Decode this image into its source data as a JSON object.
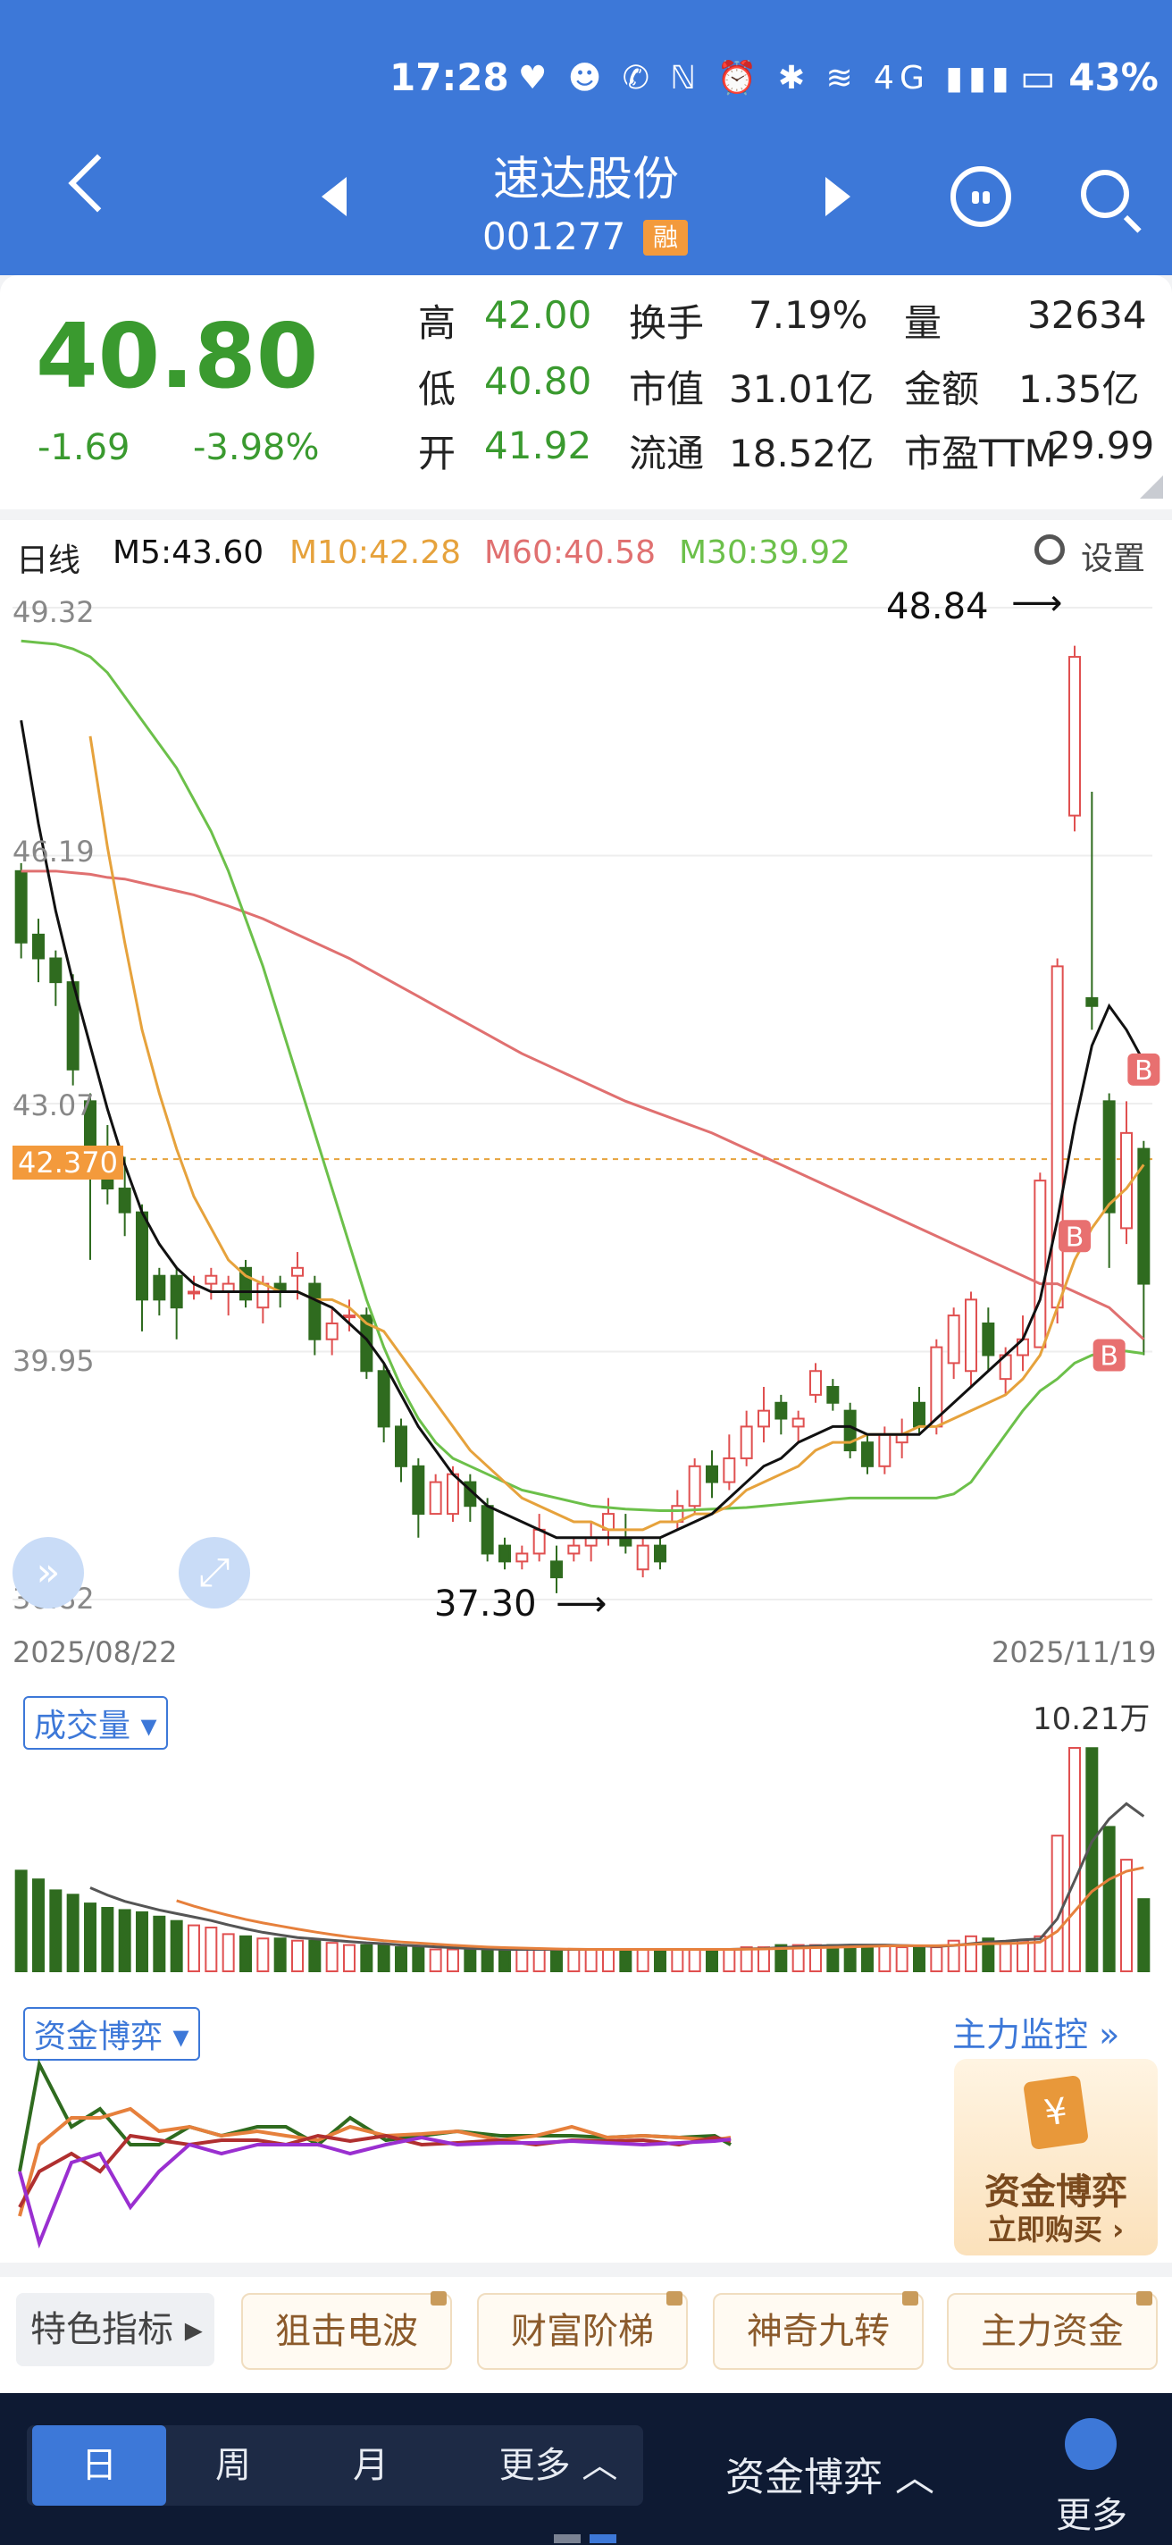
{
  "status": {
    "time": "17:28",
    "icons": "♥ ☻ ✆ ℕ ⏰ ✱ ≋ 4G ▮▮▮",
    "battery": "▭ 43%"
  },
  "header": {
    "stock_name": "速达股份",
    "stock_code": "001277",
    "badge": "融"
  },
  "quote": {
    "price": "40.80",
    "change": "-1.69",
    "change_pct": "-3.98%",
    "high_label": "高",
    "high": "42.00",
    "low_label": "低",
    "low": "40.80",
    "open_label": "开",
    "open": "41.92",
    "turnover_label": "换手",
    "turnover": "7.19%",
    "mcap_label": "市值",
    "mcap": "31.01亿",
    "float_label": "流通",
    "float": "18.52亿",
    "vol_label": "量",
    "vol": "32634",
    "amount_label": "金额",
    "amount": "1.35亿",
    "pe_label": "市盈TTM",
    "pe": "29.99"
  },
  "chart_header": {
    "period": "日线",
    "m5": "M5:43.60",
    "m10": "M10:42.28",
    "m60": "M60:40.58",
    "m30": "M30:39.92",
    "settings": "设置",
    "colors": {
      "m5": "#111111",
      "m10": "#e6a23c",
      "m60": "#e07070",
      "m30": "#6cc04a",
      "up": "#e05050",
      "down": "#2f6b1f"
    }
  },
  "chart_data": {
    "type": "candlestick",
    "y_ticks": [
      "49.32",
      "46.19",
      "43.07",
      "39.95",
      "36.82"
    ],
    "ylim": [
      36.82,
      49.32
    ],
    "current_price_tag": "42.370",
    "date_start": "2025/08/22",
    "date_end": "2025/11/19",
    "high_annotation": "48.84",
    "low_annotation": "37.30",
    "candles": [
      {
        "o": 46.0,
        "h": 46.1,
        "l": 44.9,
        "c": 45.1
      },
      {
        "o": 45.2,
        "h": 45.4,
        "l": 44.6,
        "c": 44.9
      },
      {
        "o": 44.9,
        "h": 45.0,
        "l": 44.3,
        "c": 44.6
      },
      {
        "o": 44.6,
        "h": 44.7,
        "l": 43.3,
        "c": 43.5
      },
      {
        "o": 43.1,
        "h": 43.2,
        "l": 41.1,
        "c": 42.5
      },
      {
        "o": 42.5,
        "h": 42.8,
        "l": 41.8,
        "c": 42.0
      },
      {
        "o": 42.0,
        "h": 42.4,
        "l": 41.4,
        "c": 41.7
      },
      {
        "o": 41.7,
        "h": 41.8,
        "l": 40.2,
        "c": 40.6
      },
      {
        "o": 40.9,
        "h": 41.0,
        "l": 40.4,
        "c": 40.6
      },
      {
        "o": 40.9,
        "h": 41.0,
        "l": 40.1,
        "c": 40.5
      },
      {
        "o": 40.7,
        "h": 40.9,
        "l": 40.6,
        "c": 40.7
      },
      {
        "o": 40.8,
        "h": 41.0,
        "l": 40.6,
        "c": 40.9
      },
      {
        "o": 40.7,
        "h": 40.9,
        "l": 40.4,
        "c": 40.8
      },
      {
        "o": 41.0,
        "h": 41.1,
        "l": 40.5,
        "c": 40.6
      },
      {
        "o": 40.5,
        "h": 40.9,
        "l": 40.3,
        "c": 40.8
      },
      {
        "o": 40.8,
        "h": 40.9,
        "l": 40.5,
        "c": 40.7
      },
      {
        "o": 40.9,
        "h": 41.2,
        "l": 40.6,
        "c": 41.0
      },
      {
        "o": 40.8,
        "h": 40.9,
        "l": 39.9,
        "c": 40.1
      },
      {
        "o": 40.1,
        "h": 40.5,
        "l": 39.9,
        "c": 40.3
      },
      {
        "o": 40.4,
        "h": 40.6,
        "l": 40.2,
        "c": 40.4
      },
      {
        "o": 40.4,
        "h": 40.5,
        "l": 39.6,
        "c": 39.7
      },
      {
        "o": 39.7,
        "h": 39.8,
        "l": 38.8,
        "c": 39.0
      },
      {
        "o": 39.0,
        "h": 39.1,
        "l": 38.3,
        "c": 38.5
      },
      {
        "o": 38.5,
        "h": 38.6,
        "l": 37.6,
        "c": 37.9
      },
      {
        "o": 37.9,
        "h": 38.4,
        "l": 37.9,
        "c": 38.3
      },
      {
        "o": 37.9,
        "h": 38.5,
        "l": 37.8,
        "c": 38.4
      },
      {
        "o": 38.3,
        "h": 38.4,
        "l": 37.8,
        "c": 38.0
      },
      {
        "o": 38.0,
        "h": 38.1,
        "l": 37.3,
        "c": 37.4
      },
      {
        "o": 37.5,
        "h": 37.6,
        "l": 37.2,
        "c": 37.3
      },
      {
        "o": 37.3,
        "h": 37.5,
        "l": 37.2,
        "c": 37.4
      },
      {
        "o": 37.4,
        "h": 37.9,
        "l": 37.3,
        "c": 37.7
      },
      {
        "o": 37.3,
        "h": 37.5,
        "l": 36.9,
        "c": 37.1
      },
      {
        "o": 37.4,
        "h": 37.6,
        "l": 37.3,
        "c": 37.5
      },
      {
        "o": 37.5,
        "h": 37.8,
        "l": 37.3,
        "c": 37.6
      },
      {
        "o": 37.7,
        "h": 38.1,
        "l": 37.5,
        "c": 37.9
      },
      {
        "o": 37.6,
        "h": 37.9,
        "l": 37.4,
        "c": 37.5
      },
      {
        "o": 37.2,
        "h": 37.6,
        "l": 37.1,
        "c": 37.5
      },
      {
        "o": 37.5,
        "h": 37.6,
        "l": 37.2,
        "c": 37.3
      },
      {
        "o": 37.8,
        "h": 38.2,
        "l": 37.7,
        "c": 38.0
      },
      {
        "o": 38.0,
        "h": 38.6,
        "l": 37.9,
        "c": 38.5
      },
      {
        "o": 38.5,
        "h": 38.7,
        "l": 38.1,
        "c": 38.3
      },
      {
        "o": 38.3,
        "h": 38.9,
        "l": 38.2,
        "c": 38.6
      },
      {
        "o": 38.6,
        "h": 39.2,
        "l": 38.5,
        "c": 39.0
      },
      {
        "o": 39.0,
        "h": 39.5,
        "l": 38.8,
        "c": 39.2
      },
      {
        "o": 39.3,
        "h": 39.4,
        "l": 38.9,
        "c": 39.1
      },
      {
        "o": 39.0,
        "h": 39.2,
        "l": 38.8,
        "c": 39.1
      },
      {
        "o": 39.4,
        "h": 39.8,
        "l": 39.3,
        "c": 39.7
      },
      {
        "o": 39.5,
        "h": 39.6,
        "l": 39.2,
        "c": 39.3
      },
      {
        "o": 39.2,
        "h": 39.3,
        "l": 38.6,
        "c": 38.7
      },
      {
        "o": 38.8,
        "h": 38.9,
        "l": 38.4,
        "c": 38.5
      },
      {
        "o": 38.5,
        "h": 39.0,
        "l": 38.4,
        "c": 38.9
      },
      {
        "o": 38.8,
        "h": 39.1,
        "l": 38.6,
        "c": 38.9
      },
      {
        "o": 39.3,
        "h": 39.5,
        "l": 38.9,
        "c": 39.0
      },
      {
        "o": 39.0,
        "h": 40.1,
        "l": 38.9,
        "c": 40.0
      },
      {
        "o": 39.8,
        "h": 40.5,
        "l": 39.6,
        "c": 40.4
      },
      {
        "o": 39.7,
        "h": 40.7,
        "l": 39.5,
        "c": 40.6
      },
      {
        "o": 40.3,
        "h": 40.5,
        "l": 39.7,
        "c": 39.9
      },
      {
        "o": 39.6,
        "h": 40.0,
        "l": 39.4,
        "c": 39.9
      },
      {
        "o": 39.9,
        "h": 40.4,
        "l": 39.7,
        "c": 40.1
      },
      {
        "o": 40.0,
        "h": 42.2,
        "l": 40.0,
        "c": 42.1
      },
      {
        "o": 40.5,
        "h": 44.9,
        "l": 40.3,
        "c": 44.8
      },
      {
        "o": 46.7,
        "h": 48.84,
        "l": 46.5,
        "c": 48.7
      },
      {
        "o": 44.4,
        "h": 47.0,
        "l": 44.0,
        "c": 44.3
      },
      {
        "o": 43.1,
        "h": 43.2,
        "l": 41.0,
        "c": 41.7
      },
      {
        "o": 41.5,
        "h": 43.1,
        "l": 41.3,
        "c": 42.7
      },
      {
        "o": 42.5,
        "h": 42.6,
        "l": 39.9,
        "c": 40.8
      }
    ],
    "ma": {
      "m5": [
        47.9,
        46.6,
        45.5,
        44.6,
        43.8,
        43.0,
        42.3,
        41.7,
        41.3,
        41.0,
        40.8,
        40.7,
        40.7,
        40.7,
        40.7,
        40.7,
        40.7,
        40.6,
        40.5,
        40.3,
        40.1,
        39.8,
        39.4,
        39.0,
        38.7,
        38.4,
        38.2,
        38.0,
        37.9,
        37.8,
        37.7,
        37.6,
        37.6,
        37.6,
        37.6,
        37.6,
        37.6,
        37.6,
        37.7,
        37.8,
        37.9,
        38.1,
        38.3,
        38.5,
        38.6,
        38.8,
        38.9,
        39.0,
        39.0,
        38.9,
        38.9,
        38.9,
        38.9,
        39.1,
        39.3,
        39.5,
        39.7,
        39.9,
        40.1,
        40.6,
        41.6,
        42.8,
        43.8,
        44.3,
        44.0,
        43.6
      ],
      "m10": [
        null,
        null,
        null,
        null,
        47.7,
        46.3,
        45.1,
        44.0,
        43.2,
        42.5,
        41.9,
        41.5,
        41.1,
        40.9,
        40.8,
        40.7,
        40.7,
        40.6,
        40.6,
        40.5,
        40.3,
        40.2,
        39.9,
        39.6,
        39.3,
        39.0,
        38.7,
        38.5,
        38.3,
        38.1,
        38.0,
        37.9,
        37.8,
        37.8,
        37.7,
        37.7,
        37.7,
        37.8,
        37.8,
        37.9,
        37.9,
        38.0,
        38.2,
        38.3,
        38.4,
        38.5,
        38.7,
        38.8,
        38.8,
        38.9,
        38.9,
        38.9,
        39.0,
        39.0,
        39.1,
        39.2,
        39.3,
        39.4,
        39.6,
        39.9,
        40.5,
        41.1,
        41.5,
        41.8,
        42.0,
        42.3
      ],
      "m60": [
        46.0,
        46.0,
        46.0,
        45.98,
        45.96,
        45.92,
        45.9,
        45.85,
        45.8,
        45.75,
        45.7,
        45.63,
        45.56,
        45.48,
        45.4,
        45.3,
        45.2,
        45.1,
        45.0,
        44.9,
        44.78,
        44.66,
        44.54,
        44.42,
        44.3,
        44.18,
        44.06,
        43.94,
        43.82,
        43.7,
        43.6,
        43.5,
        43.4,
        43.3,
        43.2,
        43.1,
        43.02,
        42.94,
        42.86,
        42.78,
        42.7,
        42.6,
        42.5,
        42.4,
        42.3,
        42.2,
        42.1,
        42.0,
        41.9,
        41.8,
        41.7,
        41.6,
        41.5,
        41.4,
        41.3,
        41.2,
        41.1,
        41.0,
        40.9,
        40.8,
        40.8,
        40.7,
        40.6,
        40.5,
        40.3,
        40.1
      ],
      "m30": [
        48.9,
        48.88,
        48.86,
        48.8,
        48.7,
        48.5,
        48.2,
        47.9,
        47.6,
        47.3,
        46.9,
        46.5,
        46.0,
        45.4,
        44.8,
        44.1,
        43.4,
        42.7,
        42.0,
        41.3,
        40.6,
        40.0,
        39.5,
        39.1,
        38.8,
        38.6,
        38.5,
        38.4,
        38.3,
        38.2,
        38.15,
        38.1,
        38.05,
        38.0,
        37.98,
        37.96,
        37.95,
        37.94,
        37.94,
        37.95,
        37.96,
        37.97,
        37.98,
        38.0,
        38.02,
        38.04,
        38.06,
        38.08,
        38.1,
        38.1,
        38.1,
        38.1,
        38.1,
        38.1,
        38.15,
        38.3,
        38.6,
        38.9,
        39.2,
        39.45,
        39.6,
        39.8,
        39.9,
        39.95,
        39.95,
        39.92
      ]
    },
    "volume": {
      "label": "成交量",
      "max_label": "10.21万",
      "values": [
        4.6,
        4.2,
        3.7,
        3.5,
        3.1,
        2.9,
        2.8,
        2.7,
        2.5,
        2.3,
        2.1,
        2.0,
        1.7,
        1.6,
        1.5,
        1.5,
        1.4,
        1.4,
        1.3,
        1.2,
        1.2,
        1.2,
        1.1,
        1.1,
        1.0,
        1.0,
        1.0,
        1.0,
        1.0,
        1.0,
        1.0,
        1.0,
        1.0,
        1.0,
        1.0,
        1.0,
        1.0,
        1.0,
        1.0,
        1.0,
        1.0,
        1.0,
        1.1,
        1.1,
        1.2,
        1.2,
        1.2,
        1.2,
        1.2,
        1.2,
        1.2,
        1.1,
        1.1,
        1.1,
        1.4,
        1.6,
        1.5,
        1.3,
        1.4,
        1.6,
        6.2,
        10.21,
        10.2,
        6.6,
        5.1,
        3.3
      ]
    },
    "money_flow": {
      "label": "资金博弈"
    }
  },
  "money_flow_side": {
    "monitor": "主力监控",
    "promo_title": "资金博弈",
    "promo_sub": "立即购买 ›",
    "promo_icon": "¥"
  },
  "features": {
    "main": "特色指标 ▸",
    "items": [
      "狙击电波",
      "财富阶梯",
      "神奇九转",
      "主力资金"
    ]
  },
  "bottom": {
    "periods": [
      "日",
      "周",
      "月",
      "更多 ︿"
    ],
    "indicator": "资金博弈 ︿",
    "more": "更多"
  }
}
